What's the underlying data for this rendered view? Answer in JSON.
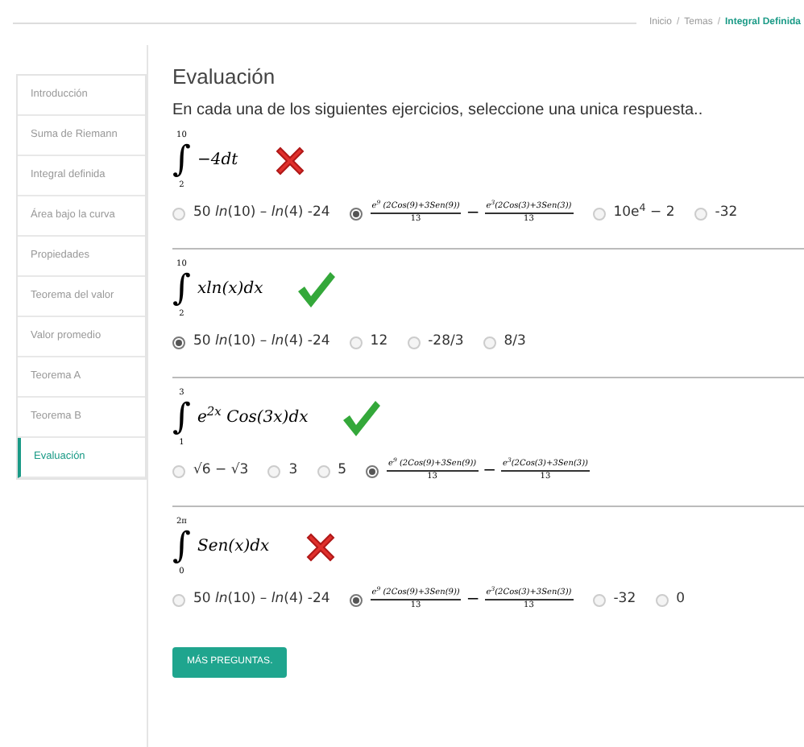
{
  "breadcrumb": {
    "separator": "/",
    "items": [
      {
        "label": "Inicio",
        "selected": false
      },
      {
        "label": "Temas",
        "selected": false
      },
      {
        "label": "Integral Definida",
        "selected": true
      }
    ]
  },
  "sidebar": {
    "items": [
      {
        "label": "Introducción",
        "selected": false
      },
      {
        "label": "Suma de Riemann",
        "selected": false
      },
      {
        "label": "Integral definida",
        "selected": false
      },
      {
        "label": "Área bajo la curva",
        "selected": false
      },
      {
        "label": "Propiedades",
        "selected": false
      },
      {
        "label": "Teorema del valor",
        "selected": false
      },
      {
        "label": "Valor promedio",
        "selected": false
      },
      {
        "label": "Teorema A",
        "selected": false
      },
      {
        "label": "Teorema B",
        "selected": false
      },
      {
        "label": "Evaluación",
        "selected": true
      }
    ]
  },
  "title": "Evaluación",
  "instructions": "En cada una de los siguientes ejercicios, seleccione una unica respuesta..",
  "questions": [
    {
      "upper": "10",
      "lower": "2",
      "integrand": "−4dt",
      "correct": false,
      "options": [
        {
          "kind": "text",
          "text": "50 *ln*(10) – *ln*(4) -24",
          "selected": false
        },
        {
          "kind": "fraction",
          "terms": [
            {
              "numerator": "e$^{9}$ (2Cos(9)+3Sen(9))",
              "denominator": "13"
            },
            {
              "numerator": "e$^{3}$(2Cos(3)+3Sen(3))",
              "denominator": "13"
            }
          ],
          "operator": "−",
          "selected": true
        },
        {
          "kind": "text",
          "text": "10e$^{4}$ − 2",
          "selected": false
        },
        {
          "kind": "text",
          "text": "-32",
          "selected": false
        }
      ]
    },
    {
      "upper": "10",
      "lower": "2",
      "integrand": "xln(x)dx",
      "correct": true,
      "options": [
        {
          "kind": "text",
          "text": "50 *ln*(10) – *ln*(4) -24",
          "selected": true
        },
        {
          "kind": "text",
          "text": "12",
          "selected": false
        },
        {
          "kind": "text",
          "text": "-28/3",
          "selected": false
        },
        {
          "kind": "text",
          "text": "8/3",
          "selected": false
        }
      ]
    },
    {
      "upper": "3",
      "lower": "1",
      "integrand": "e$^{2x}$ Cos(3x)dx",
      "correct": true,
      "options": [
        {
          "kind": "text",
          "text": "√6 − √3",
          "selected": false
        },
        {
          "kind": "text",
          "text": "3",
          "selected": false
        },
        {
          "kind": "text",
          "text": "5",
          "selected": false
        },
        {
          "kind": "fraction",
          "terms": [
            {
              "numerator": "e$^{9}$ (2Cos(9)+3Sen(9))",
              "denominator": "13"
            },
            {
              "numerator": "e$^{3}$(2Cos(3)+3Sen(3))",
              "denominator": "13"
            }
          ],
          "operator": "−",
          "selected": true
        }
      ]
    },
    {
      "upper": "2π",
      "lower": "0",
      "integrand": "Sen(x)dx",
      "correct": false,
      "options": [
        {
          "kind": "text",
          "text": "50 *ln*(10) – *ln*(4) -24",
          "selected": false
        },
        {
          "kind": "fraction",
          "terms": [
            {
              "numerator": "e$^{9}$ (2Cos(9)+3Sen(9))",
              "denominator": "13"
            },
            {
              "numerator": "e$^{3}$(2Cos(3)+3Sen(3))",
              "denominator": "13"
            }
          ],
          "operator": "−",
          "selected": true
        },
        {
          "kind": "text",
          "text": "-32",
          "selected": false
        },
        {
          "kind": "text",
          "text": "0",
          "selected": false
        }
      ]
    }
  ],
  "integral_sign": "∫",
  "more_button": "MÁS PREGUNTAS."
}
